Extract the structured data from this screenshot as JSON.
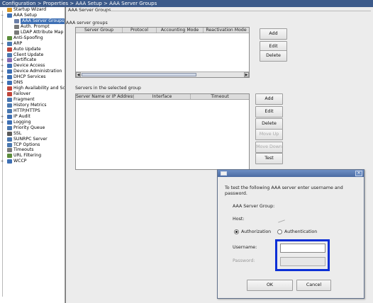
{
  "breadcrumb": "Configuration > Properties > AAA Setup > AAA Server Groups",
  "tree": {
    "items": [
      {
        "label": "Startup Wizard",
        "icon": "wizard-icon",
        "color": "#d99a2b",
        "level": 1,
        "expander": ""
      },
      {
        "label": "AAA Setup",
        "icon": "folder-icon",
        "color": "#3d6fb4",
        "level": 1,
        "expander": "−"
      },
      {
        "label": "AAA Server Groups",
        "icon": "server-group-icon",
        "color": "#6c7fa8",
        "level": 2,
        "expander": "",
        "selected": true
      },
      {
        "label": "Auth. Prompt",
        "icon": "prompt-icon",
        "color": "#7a7a7a",
        "level": 2,
        "expander": ""
      },
      {
        "label": "LDAP Attribute Map",
        "icon": "ldap-icon",
        "color": "#7a7a7a",
        "level": 2,
        "expander": ""
      },
      {
        "label": "Anti-Spoofing",
        "icon": "shield-icon",
        "color": "#5b8c3a",
        "level": 1,
        "expander": ""
      },
      {
        "label": "ARP",
        "icon": "arp-icon",
        "color": "#4a78b0",
        "level": 1,
        "expander": "+"
      },
      {
        "label": "Auto Update",
        "icon": "update-icon",
        "color": "#c0453a",
        "level": 1,
        "expander": ""
      },
      {
        "label": "Client Update",
        "icon": "client-update-icon",
        "color": "#4a78b0",
        "level": 1,
        "expander": ""
      },
      {
        "label": "Certificate",
        "icon": "certificate-icon",
        "color": "#8a6cb0",
        "level": 1,
        "expander": "+"
      },
      {
        "label": "Device Access",
        "icon": "device-access-icon",
        "color": "#3d6fb4",
        "level": 1,
        "expander": "+"
      },
      {
        "label": "Device Administration",
        "icon": "device-admin-icon",
        "color": "#3d6fb4",
        "level": 1,
        "expander": "+"
      },
      {
        "label": "DHCP Services",
        "icon": "dhcp-icon",
        "color": "#3d6fb4",
        "level": 1,
        "expander": "+"
      },
      {
        "label": "DNS",
        "icon": "dns-icon",
        "color": "#3d6fb4",
        "level": 1,
        "expander": "+"
      },
      {
        "label": "High Availability and Scal",
        "icon": "high-availability-icon",
        "color": "#c0453a",
        "level": 1,
        "expander": ""
      },
      {
        "label": "Failover",
        "icon": "failover-icon",
        "color": "#c0453a",
        "level": 1,
        "expander": ""
      },
      {
        "label": "Fragment",
        "icon": "fragment-icon",
        "color": "#4a78b0",
        "level": 1,
        "expander": ""
      },
      {
        "label": "History Metrics",
        "icon": "history-metrics-icon",
        "color": "#4a78b0",
        "level": 1,
        "expander": ""
      },
      {
        "label": "HTTP/HTTPS",
        "icon": "http-icon",
        "color": "#4a78b0",
        "level": 1,
        "expander": ""
      },
      {
        "label": "IP Audit",
        "icon": "ip-audit-icon",
        "color": "#3d6fb4",
        "level": 1,
        "expander": "+"
      },
      {
        "label": "Logging",
        "icon": "logging-icon",
        "color": "#3d6fb4",
        "level": 1,
        "expander": "+"
      },
      {
        "label": "Priority Queue",
        "icon": "priority-queue-icon",
        "color": "#4a78b0",
        "level": 1,
        "expander": ""
      },
      {
        "label": "SSL",
        "icon": "ssl-icon",
        "color": "#5a5a5a",
        "level": 1,
        "expander": ""
      },
      {
        "label": "SUNRPC Server",
        "icon": "sunrpc-icon",
        "color": "#4a78b0",
        "level": 1,
        "expander": ""
      },
      {
        "label": "TCP Options",
        "icon": "tcp-icon",
        "color": "#4a78b0",
        "level": 1,
        "expander": ""
      },
      {
        "label": "Timeouts",
        "icon": "timeouts-icon",
        "color": "#7a7a7a",
        "level": 1,
        "expander": ""
      },
      {
        "label": "URL Filtering",
        "icon": "url-filtering-icon",
        "color": "#5b8c3a",
        "level": 1,
        "expander": ""
      },
      {
        "label": "WCCP",
        "icon": "wccp-icon",
        "color": "#3d6fb4",
        "level": 1,
        "expander": "+"
      }
    ]
  },
  "main": {
    "group_title": "AAA Server Groups",
    "server_groups": {
      "title": "AAA server groups",
      "columns": [
        "Server Group",
        "Protocol",
        "Accounting Mode",
        "Reactivation Mode"
      ],
      "buttons": {
        "add": "Add",
        "edit": "Edit",
        "delete": "Delete"
      }
    },
    "servers": {
      "title": "Servers in the selected group",
      "columns": [
        "Server Name or IP Address",
        "Interface",
        "Timeout"
      ],
      "buttons": {
        "add": "Add",
        "edit": "Edit",
        "delete": "Delete",
        "move_up": "Move Up",
        "move_down": "Move Down",
        "test": "Test"
      }
    }
  },
  "dialog": {
    "instruction": "To test the following AAA server enter username and password.",
    "server_group_label": "AAA Server Group:",
    "host_label": "Host:",
    "radio_authorization": "Authorization",
    "radio_authentication": "Authentication",
    "selected_mode": "authorization",
    "username_label": "Username:",
    "password_label": "Password:",
    "username_value": "",
    "password_value": "",
    "ok_label": "OK",
    "cancel_label": "Cancel",
    "close_glyph": "✕"
  },
  "colors": {
    "highlight": "#0b2fd6",
    "selection": "#3d6fb4"
  }
}
